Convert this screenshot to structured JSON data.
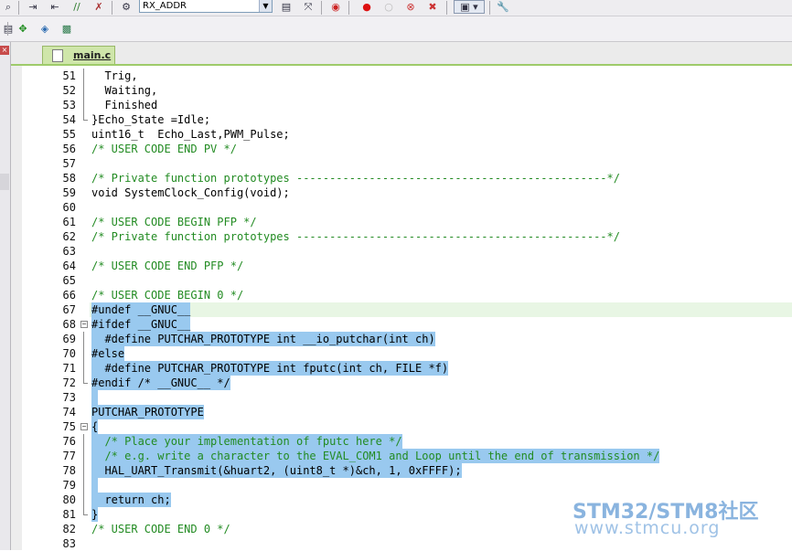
{
  "toolbar": {
    "target_combo": "RX_ADDR"
  },
  "tabs": [
    {
      "label": "main.c",
      "active": true
    }
  ],
  "colors": {
    "comment": "#228b22",
    "selection": "#99c9ef",
    "tab_active": "#cfe6aa",
    "current_line": "#e8f6e4"
  },
  "editor": {
    "lines": [
      {
        "num": "51",
        "text": "  Trig,",
        "type": "code",
        "sel": false
      },
      {
        "num": "52",
        "text": "  Waiting,",
        "type": "code",
        "sel": false
      },
      {
        "num": "53",
        "text": "  Finished",
        "type": "code",
        "sel": false
      },
      {
        "num": "54",
        "text": "}Echo_State =Idle;",
        "type": "code",
        "sel": false
      },
      {
        "num": "55",
        "text": "uint16_t  Echo_Last,PWM_Pulse;",
        "type": "code",
        "sel": false
      },
      {
        "num": "56",
        "text": "/* USER CODE END PV */",
        "type": "comment",
        "sel": false
      },
      {
        "num": "57",
        "text": "",
        "type": "code",
        "sel": false
      },
      {
        "num": "58",
        "text": "/* Private function prototypes -----------------------------------------------*/",
        "type": "comment",
        "sel": false
      },
      {
        "num": "59",
        "text": "void SystemClock_Config(void);",
        "type": "code",
        "sel": false
      },
      {
        "num": "60",
        "text": "",
        "type": "code",
        "sel": false
      },
      {
        "num": "61",
        "text": "/* USER CODE BEGIN PFP */",
        "type": "comment",
        "sel": false
      },
      {
        "num": "62",
        "text": "/* Private function prototypes -----------------------------------------------*/",
        "type": "comment",
        "sel": false
      },
      {
        "num": "63",
        "text": "",
        "type": "code",
        "sel": false
      },
      {
        "num": "64",
        "text": "/* USER CODE END PFP */",
        "type": "comment",
        "sel": false
      },
      {
        "num": "65",
        "text": "",
        "type": "code",
        "sel": false
      },
      {
        "num": "66",
        "text": "/* USER CODE BEGIN 0 */",
        "type": "comment",
        "sel": false
      },
      {
        "num": "67",
        "text": "#undef __GNUC__",
        "type": "code",
        "sel": true
      },
      {
        "num": "68",
        "text": "#ifdef __GNUC__",
        "type": "code",
        "sel": true
      },
      {
        "num": "69",
        "text": "  #define PUTCHAR_PROTOTYPE int __io_putchar(int ch)",
        "type": "code",
        "sel": true
      },
      {
        "num": "70",
        "text": "#else",
        "type": "code",
        "sel": true
      },
      {
        "num": "71",
        "text": "  #define PUTCHAR_PROTOTYPE int fputc(int ch, FILE *f)",
        "type": "code",
        "sel": true
      },
      {
        "num": "72",
        "text": "#endif /* __GNUC__ */",
        "type": "code",
        "sel": true
      },
      {
        "num": "73",
        "text": "",
        "type": "code",
        "sel": true
      },
      {
        "num": "74",
        "text": "PUTCHAR_PROTOTYPE",
        "type": "code",
        "sel": true
      },
      {
        "num": "75",
        "text": "{",
        "type": "code",
        "sel": true
      },
      {
        "num": "76",
        "text": "  /* Place your implementation of fputc here */",
        "type": "comment",
        "sel": true
      },
      {
        "num": "77",
        "text": "  /* e.g. write a character to the EVAL_COM1 and Loop until the end of transmission */",
        "type": "comment",
        "sel": true
      },
      {
        "num": "78",
        "text": "  HAL_UART_Transmit(&huart2, (uint8_t *)&ch, 1, 0xFFFF);",
        "type": "code",
        "sel": true
      },
      {
        "num": "79",
        "text": "",
        "type": "code",
        "sel": true
      },
      {
        "num": "80",
        "text": "  return ch;",
        "type": "code",
        "sel": true
      },
      {
        "num": "81",
        "text": "}",
        "type": "code",
        "sel": true
      },
      {
        "num": "82",
        "text": "/* USER CODE END 0 */",
        "type": "comment",
        "sel": false
      },
      {
        "num": "83",
        "text": "",
        "type": "code",
        "sel": false
      }
    ]
  },
  "watermark": {
    "brand": "STM32/STM8社区",
    "url": "www.stmcu.org"
  }
}
